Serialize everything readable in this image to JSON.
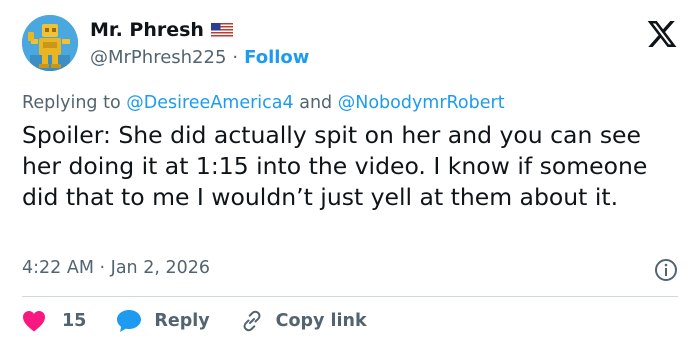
{
  "author": {
    "name": "Mr. Phresh",
    "handle": "@MrPhresh225",
    "separator": "·",
    "follow_label": "Follow",
    "flag_icon": "us-flag-icon",
    "avatar_icon": "yellow-robot-avatar"
  },
  "brand_icon": "x-logo-icon",
  "reply_context": {
    "prefix": "Replying to",
    "mention_1": "@DesireeAmerica4",
    "conjunction": "and",
    "mention_2": "@NobodymrRobert"
  },
  "tweet": {
    "text": "Spoiler: She did actually spit on her and you can see her doing it at 1:15 into the video. I know if someone did that to me I wouldn’t just yell at them about it.",
    "time": "4:22 AM",
    "date_separator": "·",
    "date": "Jan 2, 2026"
  },
  "actions": {
    "like_count": "15",
    "reply_label": "Reply",
    "copy_link_label": "Copy link"
  },
  "colors": {
    "accent": "#1d9bf0",
    "like": "#f91880",
    "text": "#0f1419",
    "muted": "#536471"
  }
}
